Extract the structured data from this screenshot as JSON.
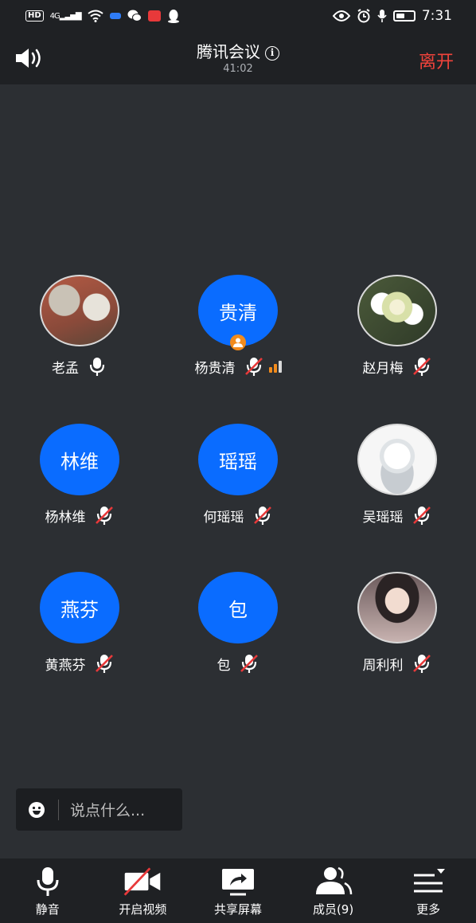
{
  "status_bar": {
    "hd": "HD",
    "network": "4G",
    "time": "7:31"
  },
  "header": {
    "title": "腾讯会议",
    "timer": "41:02",
    "leave_label": "离开"
  },
  "participants": [
    {
      "name": "老孟",
      "avatar_text": "",
      "avatar_type": "photo",
      "mic": "on",
      "host": false
    },
    {
      "name": "杨贵清",
      "avatar_text": "贵清",
      "avatar_type": "text",
      "mic": "muted",
      "host": true
    },
    {
      "name": "赵月梅",
      "avatar_text": "",
      "avatar_type": "photo",
      "mic": "muted",
      "host": false
    },
    {
      "name": "杨林维",
      "avatar_text": "林维",
      "avatar_type": "text",
      "mic": "muted",
      "host": false
    },
    {
      "name": "何瑶瑶",
      "avatar_text": "瑶瑶",
      "avatar_type": "text",
      "mic": "muted",
      "host": false
    },
    {
      "name": "吴瑶瑶",
      "avatar_text": "",
      "avatar_type": "photo",
      "mic": "muted",
      "host": false
    },
    {
      "name": "黄燕芬",
      "avatar_text": "燕芬",
      "avatar_type": "text",
      "mic": "muted",
      "host": false
    },
    {
      "name": "包",
      "avatar_text": "包",
      "avatar_type": "text",
      "mic": "muted",
      "host": false
    },
    {
      "name": "周利利",
      "avatar_text": "",
      "avatar_type": "photo",
      "mic": "muted",
      "host": false
    }
  ],
  "chat": {
    "placeholder": "说点什么..."
  },
  "toolbar": {
    "mute_label": "静音",
    "video_label": "开启视频",
    "share_label": "共享屏幕",
    "members_label": "成员(9)",
    "more_label": "更多"
  },
  "colors": {
    "avatar_blue": "#0a6cff",
    "leave_red": "#f0433b",
    "host_orange": "#f28b1c",
    "muted_red": "#e8393a"
  }
}
